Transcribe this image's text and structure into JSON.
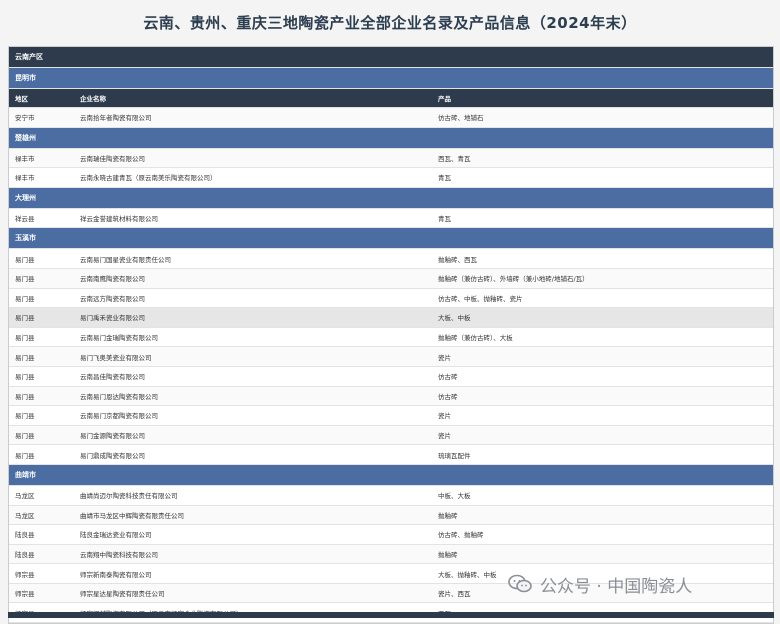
{
  "title": "云南、贵州、重庆三地陶瓷产业全部企业名录及产品信息（2024年末）",
  "region": "云南产区",
  "headers": {
    "area": "地区",
    "company": "企业名称",
    "product": "产品"
  },
  "cities": [
    {
      "name": "昆明市",
      "rows": [
        {
          "area": "安宁市",
          "company": "云南拾年者陶瓷有限公司",
          "product": "仿古砖、地铺石"
        }
      ]
    },
    {
      "name": "楚雄州",
      "rows": [
        {
          "area": "禄丰市",
          "company": "云南瑞佳陶瓷有限公司",
          "product": "西瓦、青瓦"
        },
        {
          "area": "禄丰市",
          "company": "云南永晓古建青瓦（原云南美乐陶瓷有限公司）",
          "product": "青瓦"
        }
      ]
    },
    {
      "name": "大理州",
      "rows": [
        {
          "area": "祥云县",
          "company": "祥云金誉建筑材料有限公司",
          "product": "青瓦"
        }
      ]
    },
    {
      "name": "玉溪市",
      "rows": [
        {
          "area": "易门县",
          "company": "云南易门国星瓷业有限责任公司",
          "product": "抛釉砖、西瓦"
        },
        {
          "area": "易门县",
          "company": "云南南鹰陶瓷有限公司",
          "product": "抛釉砖（兼仿古砖）、外墙砖（兼小地砖/地铺石/瓦）"
        },
        {
          "area": "易门县",
          "company": "云南远方陶瓷有限公司",
          "product": "仿古砖、中板、抛釉砖、瓷片"
        },
        {
          "area": "易门县",
          "company": "易门禹禾瓷业有限公司",
          "product": "大板、中板",
          "hl": true
        },
        {
          "area": "易门县",
          "company": "云南易门金瑞陶瓷有限公司",
          "product": "抛釉砖（兼仿古砖）、大板"
        },
        {
          "area": "易门县",
          "company": "易门飞奥美瓷业有限公司",
          "product": "瓷片"
        },
        {
          "area": "易门县",
          "company": "云南昌佳陶瓷有限公司",
          "product": "仿古砖"
        },
        {
          "area": "易门县",
          "company": "云南易门恩达陶瓷有限公司",
          "product": "仿古砖"
        },
        {
          "area": "易门县",
          "company": "云南易门京都陶瓷有限公司",
          "product": "瓷片"
        },
        {
          "area": "易门县",
          "company": "易门金源陶瓷有限公司",
          "product": "瓷片"
        },
        {
          "area": "易门县",
          "company": "易门鼎成陶瓷有限公司",
          "product": "琉璃瓦配件"
        }
      ]
    },
    {
      "name": "曲靖市",
      "rows": [
        {
          "area": "马龙区",
          "company": "曲靖尚迈尔陶瓷科技责任有限公司",
          "product": "中板、大板"
        },
        {
          "area": "马龙区",
          "company": "曲靖市马龙区中辉陶瓷有限责任公司",
          "product": "抛釉砖"
        },
        {
          "area": "陆良县",
          "company": "陆良金瑞达瓷业有限公司",
          "product": "仿古砖、抛釉砖"
        },
        {
          "area": "陆良县",
          "company": "云南翔中陶瓷科技有限公司",
          "product": "抛釉砖"
        },
        {
          "area": "师宗县",
          "company": "师宗新南泰陶瓷有限公司",
          "product": "大板、抛釉砖、中板"
        },
        {
          "area": "师宗县",
          "company": "师宗星达星陶瓷有限责任公司",
          "product": "瓷片、西瓦"
        },
        {
          "area": "师宗县",
          "company": "师宗辉越陶瓷有限公司（原云南师宗金曲陶瓷有限公司）",
          "product": "西瓦"
        }
      ]
    }
  ],
  "watermark": "公众号 · 中国陶瓷人"
}
